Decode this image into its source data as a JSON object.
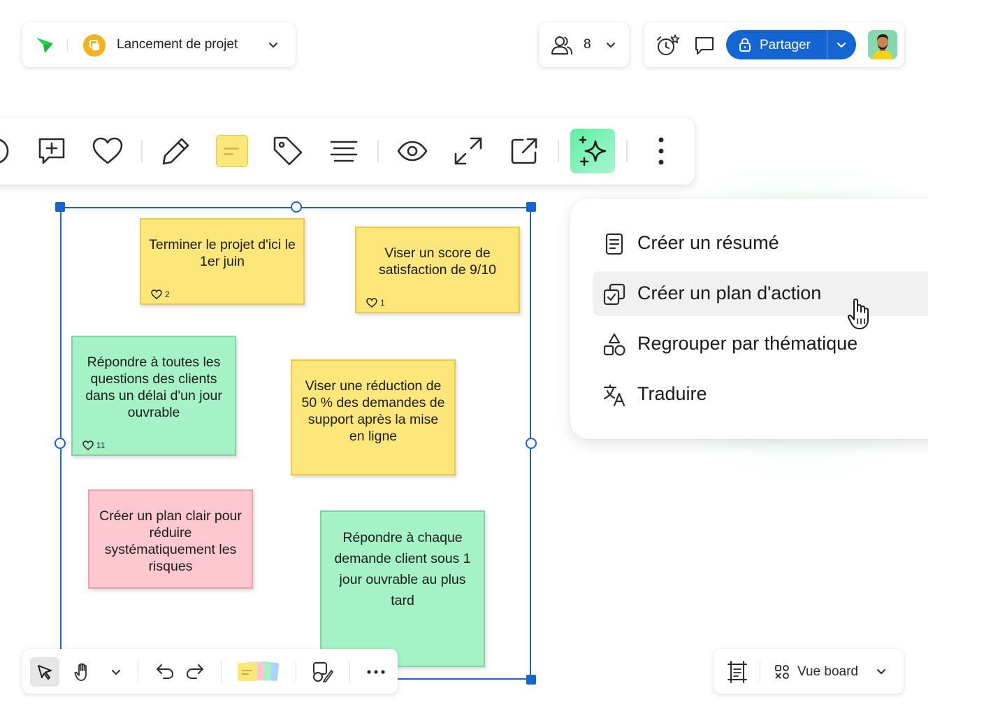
{
  "header": {
    "board_title": "Lancement de projet",
    "collaborator_count": "8",
    "share_label": "Partager"
  },
  "toolbar": {
    "icons": [
      "reaction-icon",
      "add-comment-icon",
      "heart-icon",
      "pencil-icon",
      "sticky-note-color-icon",
      "tag-icon",
      "text-align-icon",
      "eye-icon",
      "expand-icon",
      "external-link-icon",
      "ai-sparkle-icon",
      "more-vertical-icon"
    ]
  },
  "ai_menu": {
    "items": [
      {
        "label": "Créer un résumé",
        "icon": "document-icon"
      },
      {
        "label": "Créer un plan d'action",
        "icon": "action-plan-icon"
      },
      {
        "label": "Regrouper par thématique",
        "icon": "shapes-icon"
      },
      {
        "label": "Traduire",
        "icon": "translate-icon"
      }
    ]
  },
  "notes": [
    {
      "text": "Terminer le projet d'ici le 1er juin",
      "likes": "2",
      "color": "#fde77a"
    },
    {
      "text": "Viser un score de satisfaction de 9/10",
      "likes": "1",
      "color": "#fde77a"
    },
    {
      "text": "Répondre à toutes les questions des clients dans un délai d'un jour ouvrable",
      "likes": "11",
      "color": "#a5f2c6"
    },
    {
      "text": "Viser une réduction de 50 % des demandes de support après la mise en ligne",
      "color": "#fde77a"
    },
    {
      "text": "Créer un plan clair pour réduire systématiquement les risques",
      "color": "#fdc8cf"
    },
    {
      "text": "Répondre à chaque demande client sous 1 jour ouvrable au plus tard",
      "color": "#a5f2c6"
    }
  ],
  "view": {
    "label": "Vue board"
  },
  "colors": {
    "accent": "#1464d2",
    "ai_button": "#7ff0b8",
    "sticky_yellow": "#fde77a",
    "sticky_green": "#a5f2c6",
    "sticky_pink": "#fdc8cf"
  }
}
